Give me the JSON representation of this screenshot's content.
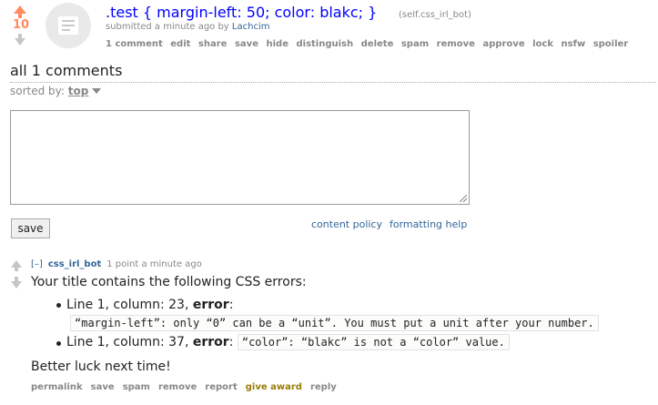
{
  "post": {
    "score": "10",
    "title": ".test { margin-left: 50; color: blakc; }",
    "domain": "(self.css_irl_bot)",
    "submitted_prefix": "submitted a minute ago by",
    "author": "Lachcim",
    "buttons": [
      "1 comment",
      "edit",
      "share",
      "save",
      "hide",
      "distinguish",
      "delete",
      "spam",
      "remove",
      "approve",
      "lock",
      "nsfw",
      "spoiler"
    ]
  },
  "comments_area": {
    "heading": "all 1 comments",
    "sorted_by_label": "sorted by:",
    "sort_value": "top",
    "save_label": "save",
    "links": [
      "content policy",
      "formatting help"
    ]
  },
  "comment": {
    "collapse": "[–]",
    "author": "css_irl_bot",
    "meta": "1 point a minute ago",
    "intro": "Your title contains the following CSS errors:",
    "errors": [
      {
        "prefix": "Line 1, column: 23,",
        "label": "error",
        "suffix": ":",
        "message": "“margin-left”: only “0” can be a “unit”. You must put a unit after your number."
      },
      {
        "prefix": "Line 1, column: 37,",
        "label": "error",
        "suffix": ":",
        "message": "“color”: “blakc” is not a “color” value."
      }
    ],
    "outro": "Better luck next time!",
    "buttons": [
      "permalink",
      "save",
      "spam",
      "remove",
      "report",
      "give award",
      "reply"
    ]
  },
  "colors": {
    "upvote": "#ff8b60",
    "link": "#0000ff",
    "author": "#369",
    "award": "#9a7d0a"
  },
  "icons": [
    "upvote-arrow-icon",
    "downvote-arrow-icon",
    "self-post-thumbnail-icon",
    "sort-caret-icon",
    "textarea-resize-icon"
  ]
}
